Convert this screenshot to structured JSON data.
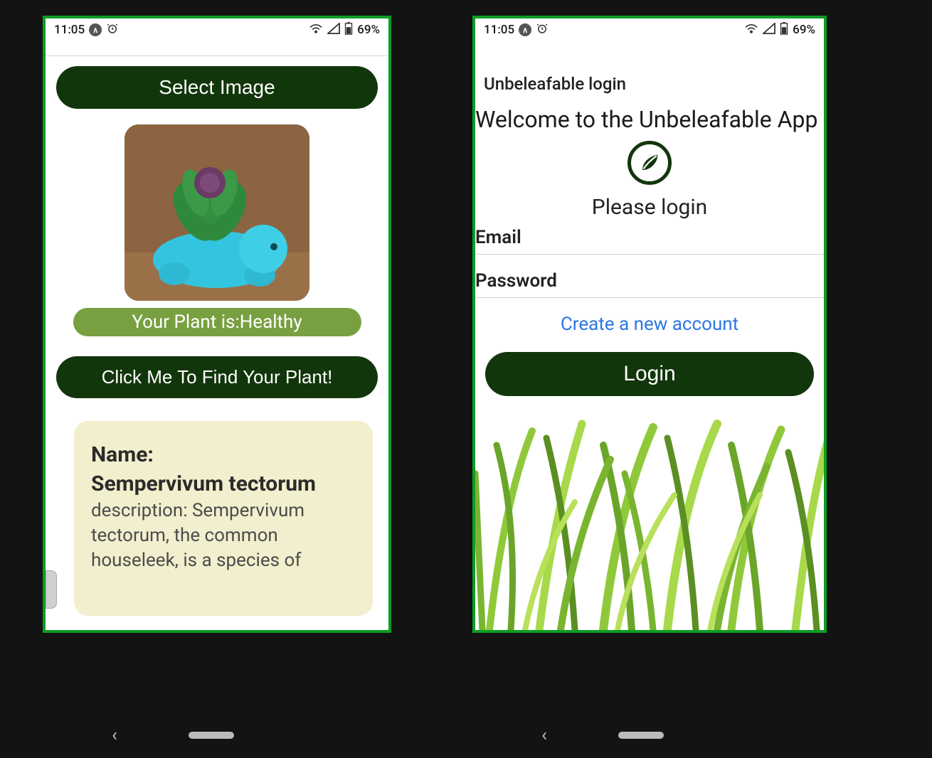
{
  "status": {
    "time": "11:05",
    "battery_text": "69%"
  },
  "left": {
    "select_image_label": "Select Image",
    "health_text": "Your Plant is:Healthy",
    "find_button_label": "Click Me To Find Your Plant!",
    "plant": {
      "name_label": "Name:",
      "name_value": "Sempervivum tectorum",
      "description_label": "description:",
      "description_text": "Sempervivum tectorum, the common houseleek, is a species of"
    }
  },
  "right": {
    "header": "Unbeleafable login",
    "welcome": "Welcome to the Unbeleafable App",
    "please_login": "Please login",
    "email_label": "Email",
    "password_label": "Password",
    "create_account": "Create a new account",
    "login_button": "Login"
  }
}
